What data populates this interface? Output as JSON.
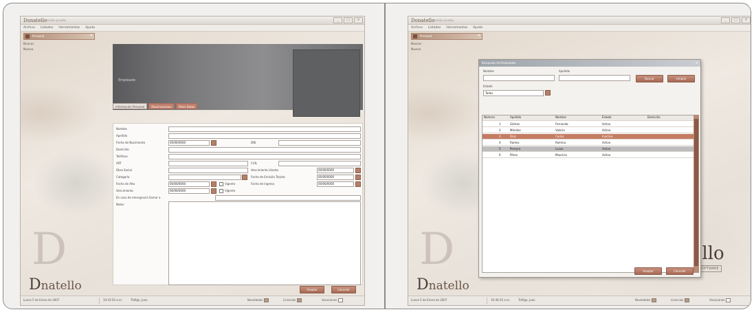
{
  "app": {
    "title": "Donatello",
    "subtitle": "versión prueba",
    "menu": [
      "Archivo",
      "Listados",
      "Herramientas",
      "Ayuda"
    ],
    "sidebar": {
      "header": "Personal",
      "items": [
        "Buscar",
        "Nuevo"
      ]
    },
    "logo": "natello",
    "logo_initial": "D"
  },
  "left": {
    "tabs": [
      "Información Personal",
      "Observaciones",
      "Otros Datos"
    ],
    "hero_text": "Empleado",
    "fields": {
      "nombre": "Nombre",
      "apellido": "Apellido",
      "fecha_nacimiento": "Fecha de Nacimiento",
      "fecha_nacimiento_val": "00/00/0000",
      "dni": "DNI",
      "domicilio": "Domicilio",
      "telefono": "Teléfono",
      "art": "ART",
      "cuil": "CUIL",
      "obra_social": "Obra Social",
      "vencimiento_libreta": "Vencimiento Libreta",
      "vencimiento_libreta_val": "00/00/0000",
      "categoria": "Categoría",
      "fecha_ingreso_tarjeta": "Fecha de Emisión Tarjeta",
      "fecha_ingreso_tarjeta_val": "00/00/0000",
      "fecha_ingreso": "Fecha de Ingreso",
      "fecha_ingreso_val": "00/00/0000",
      "fecha_alta": "Fecha de Alta",
      "fecha_alta_val": "00/00/0000",
      "fecha_alta_chk": "Vigente",
      "vencimiento": "Vencimiento",
      "vencimiento_val": "00/00/0000",
      "vencimiento_chk": "Vigente",
      "en_caso": "En caso de emergencia llamar a",
      "notas": "Notas"
    },
    "buttons": {
      "aceptar": "Aceptar",
      "cancelar": "Cancelar"
    }
  },
  "right": {
    "dialog_title": "Búsqueda de Empleados",
    "labels": {
      "nombre": "Nombre",
      "apellido": "Apellido",
      "estado": "Estado"
    },
    "estado_value": "Todos",
    "buttons": {
      "buscar": "Buscar",
      "limpiar": "Limpiar",
      "aceptar": "Aceptar",
      "cancelar": "Cancelar"
    },
    "columns": [
      "Número",
      "Apellido",
      "Nombre",
      "Estado",
      "Domicilio"
    ],
    "rows": [
      {
        "num": "1",
        "apellido": "Gómez",
        "nombre": "Fernanda",
        "estado": "Activo",
        "dom": ""
      },
      {
        "num": "2",
        "apellido": "Méndez",
        "nombre": "Valeria",
        "estado": "Activo",
        "dom": ""
      },
      {
        "num": "3",
        "apellido": "Díaz",
        "nombre": "Carlos",
        "estado": "Inactivo",
        "dom": ""
      },
      {
        "num": "4",
        "apellido": "Ramos",
        "nombre": "Romina",
        "estado": "Activo",
        "dom": ""
      },
      {
        "num": "5",
        "apellido": "Pereyra",
        "nombre": "Lucas",
        "estado": "Activo",
        "dom": ""
      },
      {
        "num": "6",
        "apellido": "Pérez",
        "nombre": "Mauricio",
        "estado": "Activo",
        "dom": ""
      }
    ],
    "watermark": "ello",
    "watermark_sub": "SOFTWARE"
  },
  "status": {
    "date": "Lunes 5 de Enero de 2007",
    "time_left": "10:43:50 a.m.",
    "time_right": "10:46:35 a.m.",
    "user": "Tráfigo, Juan",
    "novedades": "Novedades",
    "licencias": "Licencias",
    "vacaciones": "Vacaciones"
  },
  "colors": {
    "accent": "#b07a64",
    "selected_row": "#c47c62",
    "hero": "#6e6e70"
  }
}
